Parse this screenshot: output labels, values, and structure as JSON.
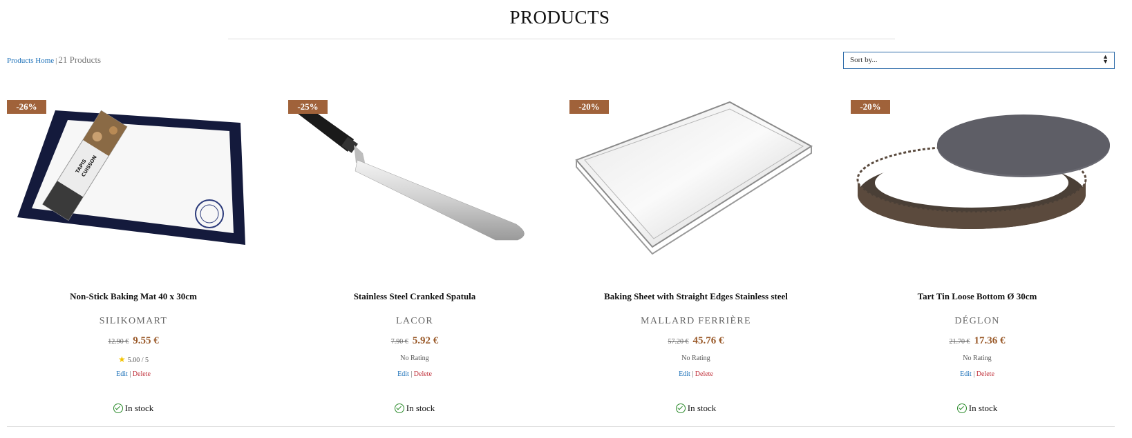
{
  "header": {
    "title": "PRODUCTS"
  },
  "toolbar": {
    "breadcrumb_link": "Products Home",
    "separator": "|",
    "product_count": "21 Products",
    "sort_placeholder": "Sort by..."
  },
  "products": [
    {
      "discount": "-26%",
      "name": "Non-Stick Baking Mat 40 x 30cm",
      "brand": "SILIKOMART",
      "old_price": "12.90 €",
      "price": "9.55 €",
      "rating": "5.00 / 5",
      "has_star": true,
      "edit": "Edit",
      "sep": "|",
      "delete": "Delete",
      "stock": "In stock",
      "image_icon": "baking-mat-image"
    },
    {
      "discount": "-25%",
      "name": "Stainless Steel Cranked Spatula",
      "brand": "LACOR",
      "old_price": "7.90 €",
      "price": "5.92 €",
      "rating": "No Rating",
      "has_star": false,
      "edit": "Edit",
      "sep": "|",
      "delete": "Delete",
      "stock": "In stock",
      "image_icon": "spatula-image"
    },
    {
      "discount": "-20%",
      "name": "Baking Sheet with Straight Edges Stainless steel",
      "brand": "MALLARD FERRIÈRE",
      "old_price": "57.20 €",
      "price": "45.76 €",
      "rating": "No Rating",
      "has_star": false,
      "edit": "Edit",
      "sep": "|",
      "delete": "Delete",
      "stock": "In stock",
      "image_icon": "baking-sheet-image"
    },
    {
      "discount": "-20%",
      "name": "Tart Tin Loose Bottom Ø 30cm",
      "brand": "DÉGLON",
      "old_price": "21.70 €",
      "price": "17.36 €",
      "rating": "No Rating",
      "has_star": false,
      "edit": "Edit",
      "sep": "|",
      "delete": "Delete",
      "stock": "In stock",
      "image_icon": "tart-tin-image"
    }
  ],
  "colors": {
    "badge": "#a0623a",
    "price": "#9a5a2a",
    "link": "#1a6fb8",
    "delete": "#c0303a",
    "stock_check": "#2a8a2a"
  }
}
